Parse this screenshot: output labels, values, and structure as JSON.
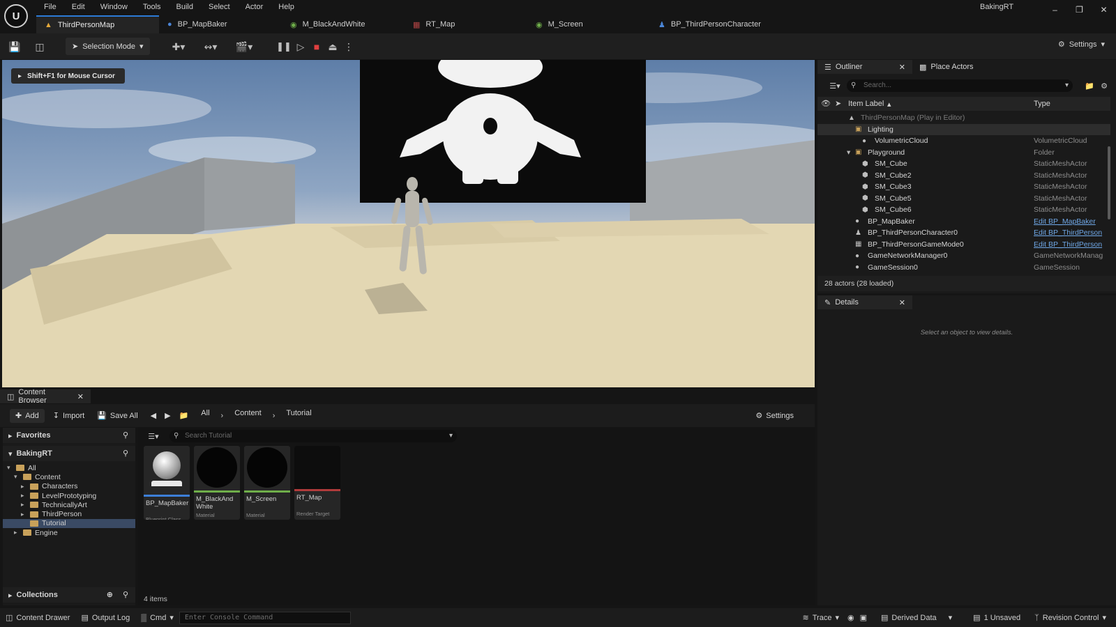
{
  "app_name": "BakingRT",
  "menu": [
    "File",
    "Edit",
    "Window",
    "Tools",
    "Build",
    "Select",
    "Actor",
    "Help"
  ],
  "tabs": [
    {
      "label": "ThirdPersonMap",
      "icon": "level-icon",
      "active": true
    },
    {
      "label": "BP_MapBaker",
      "icon": "blueprint-icon"
    },
    {
      "label": "M_BlackAndWhite",
      "icon": "material-icon"
    },
    {
      "label": "RT_Map",
      "icon": "render-target-icon"
    },
    {
      "label": "M_Screen",
      "icon": "material-icon"
    },
    {
      "label": "BP_ThirdPersonCharacter",
      "icon": "blueprint-icon"
    }
  ],
  "toolbar": {
    "selection_mode": "Selection Mode",
    "settings": "Settings"
  },
  "viewport": {
    "hint": "Shift+F1 for Mouse Cursor"
  },
  "outliner": {
    "tab_label": "Outliner",
    "place_actors_label": "Place Actors",
    "search_placeholder": "Search...",
    "col_label": "Item Label",
    "col_type": "Type",
    "rows": [
      {
        "label": "ThirdPersonMap (Play in Editor)",
        "type": "",
        "indent": 0,
        "kind": "world",
        "dim": true
      },
      {
        "label": "Lighting",
        "type": "",
        "indent": 1,
        "kind": "folder",
        "sel": true
      },
      {
        "label": "VolumetricCloud",
        "type": "VolumetricCloud",
        "indent": 2,
        "kind": "actor"
      },
      {
        "label": "Playground",
        "type": "Folder",
        "indent": 1,
        "kind": "folder-open"
      },
      {
        "label": "SM_Cube",
        "type": "StaticMeshActor",
        "indent": 2,
        "kind": "mesh"
      },
      {
        "label": "SM_Cube2",
        "type": "StaticMeshActor",
        "indent": 2,
        "kind": "mesh"
      },
      {
        "label": "SM_Cube3",
        "type": "StaticMeshActor",
        "indent": 2,
        "kind": "mesh"
      },
      {
        "label": "SM_Cube5",
        "type": "StaticMeshActor",
        "indent": 2,
        "kind": "mesh"
      },
      {
        "label": "SM_Cube6",
        "type": "StaticMeshActor",
        "indent": 2,
        "kind": "mesh"
      },
      {
        "label": "BP_MapBaker",
        "type": "Edit BP_MapBaker",
        "indent": 1,
        "kind": "actor",
        "link": true
      },
      {
        "label": "BP_ThirdPersonCharacter0",
        "type": "Edit BP_ThirdPerson",
        "indent": 1,
        "kind": "pawn",
        "link": true
      },
      {
        "label": "BP_ThirdPersonGameMode0",
        "type": "Edit BP_ThirdPerson",
        "indent": 1,
        "kind": "gamemode",
        "link": true
      },
      {
        "label": "GameNetworkManager0",
        "type": "GameNetworkManag",
        "indent": 1,
        "kind": "actor"
      },
      {
        "label": "GameSession0",
        "type": "GameSession",
        "indent": 1,
        "kind": "actor"
      }
    ],
    "footer": "28 actors (28 loaded)"
  },
  "details": {
    "tab_label": "Details",
    "empty_text": "Select an object to view details."
  },
  "content_browser": {
    "tab_label": "Content Browser",
    "add": "Add",
    "import": "Import",
    "save_all": "Save All",
    "breadcrumb": [
      "All",
      "Content",
      "Tutorial"
    ],
    "settings": "Settings",
    "favorites": "Favorites",
    "project": "BakingRT",
    "collections": "Collections",
    "search_placeholder": "Search Tutorial",
    "tree": [
      {
        "label": "All",
        "indent": 0,
        "expanded": true
      },
      {
        "label": "Content",
        "indent": 1,
        "expanded": true
      },
      {
        "label": "Characters",
        "indent": 2
      },
      {
        "label": "LevelPrototyping",
        "indent": 2
      },
      {
        "label": "TechnicallyArt",
        "indent": 2
      },
      {
        "label": "ThirdPerson",
        "indent": 2
      },
      {
        "label": "Tutorial",
        "indent": 2,
        "sel": true
      },
      {
        "label": "Engine",
        "indent": 1
      }
    ],
    "assets": [
      {
        "name": "BP_MapBaker",
        "type": "Blueprint Class",
        "color": "#3d7fd8",
        "thumb": "sphere"
      },
      {
        "name": "M_BlackAnd White",
        "type": "Material",
        "color": "#6fae4a",
        "thumb": "black-sphere"
      },
      {
        "name": "M_Screen",
        "type": "Material",
        "color": "#6fae4a",
        "thumb": "black-sphere"
      },
      {
        "name": "RT_Map",
        "type": "Render Target",
        "color": "#b13b3b",
        "thumb": "black-square"
      }
    ],
    "count": "4 items"
  },
  "statusbar": {
    "content_drawer": "Content Drawer",
    "output_log": "Output Log",
    "cmd": "Cmd",
    "console_placeholder": "Enter Console Command",
    "trace": "Trace",
    "derived_data": "Derived Data",
    "unsaved": "1 Unsaved",
    "revision_control": "Revision Control"
  }
}
